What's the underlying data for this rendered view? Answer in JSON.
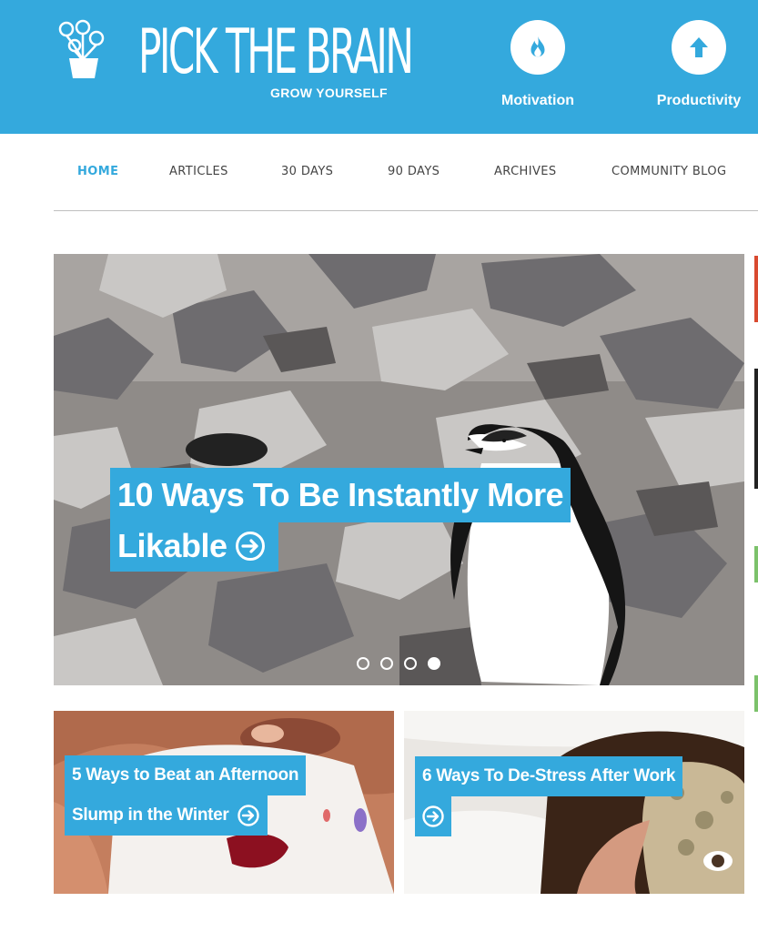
{
  "header": {
    "logo_title": "PICK THE BRAIN",
    "logo_tagline": "GROW YOURSELF",
    "background_color": "#34a9dd",
    "categories": [
      {
        "label": "Motivation",
        "icon": "flame-icon"
      },
      {
        "label": "Productivity",
        "icon": "arrow-up-icon"
      }
    ]
  },
  "nav": {
    "items": [
      {
        "label": "HOME",
        "active": true
      },
      {
        "label": "ARTICLES",
        "active": false
      },
      {
        "label": "30 DAYS",
        "active": false
      },
      {
        "label": "90 DAYS",
        "active": false
      },
      {
        "label": "ARCHIVES",
        "active": false
      },
      {
        "label": "COMMUNITY BLOG",
        "active": false
      }
    ],
    "active_color": "#34a9dd"
  },
  "hero": {
    "title_line1": "10 Ways To Be Instantly More",
    "title_line2": "Likable",
    "arrow_icon": "circle-arrow-right-icon",
    "slides_total": 4,
    "active_slide": 4
  },
  "cards": [
    {
      "line1": "5 Ways to Beat an Afternoon",
      "line2": "Slump in the Winter",
      "arrow_icon": "circle-arrow-right-icon"
    },
    {
      "line1": "6 Ways To De-Stress After Work",
      "arrow_icon": "circle-arrow-right-icon"
    }
  ],
  "colors": {
    "accent": "#34a9dd",
    "text": "#444444",
    "white": "#ffffff"
  }
}
